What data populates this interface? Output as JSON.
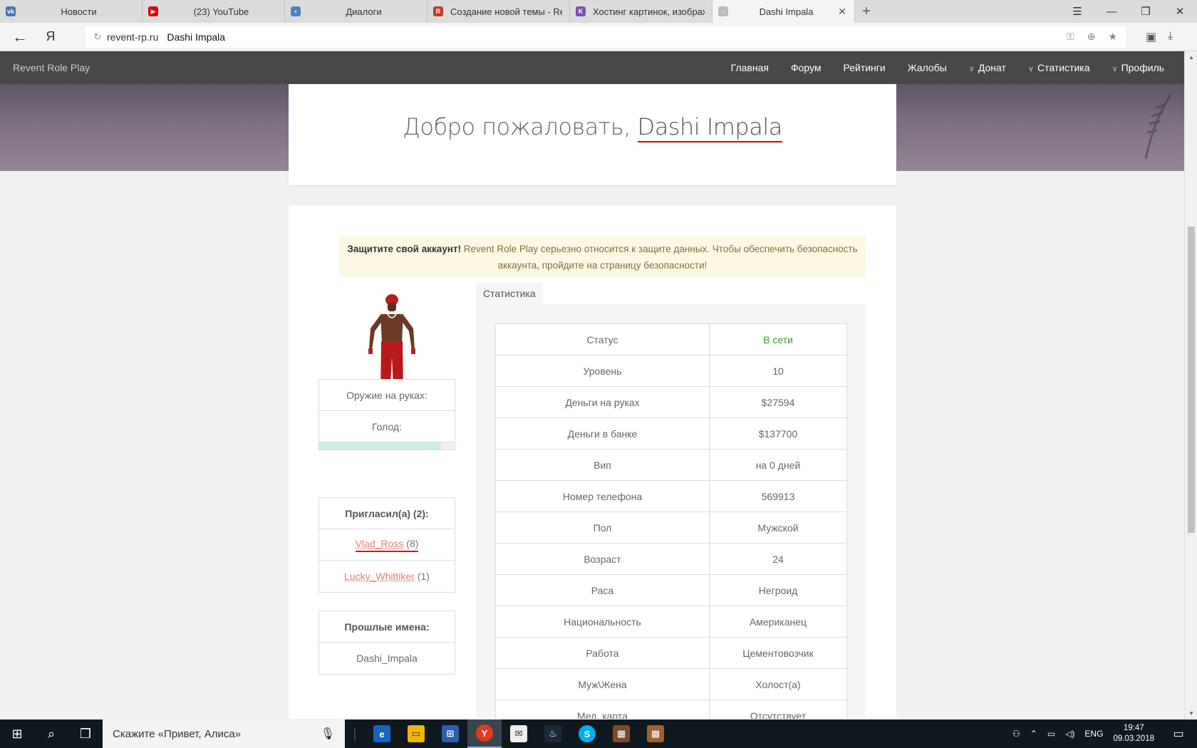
{
  "browser": {
    "tabs": [
      {
        "title": "Новости",
        "favicon": "vk-icon",
        "color": "#4a76a8",
        "glyph": "vk"
      },
      {
        "title": "(23) YouTube",
        "favicon": "youtube-icon",
        "color": "#e00000",
        "glyph": "▶"
      },
      {
        "title": "Диалоги",
        "favicon": "chat-icon",
        "color": "#5181b8",
        "glyph": "▪"
      },
      {
        "title": "Создание новой темы - Rev",
        "favicon": "revent-icon",
        "color": "#c0392b",
        "glyph": "R"
      },
      {
        "title": "Хостинг картинок, изображ",
        "favicon": "k-icon",
        "color": "#7b4fb3",
        "glyph": "K"
      },
      {
        "title": "Dashi Impala",
        "favicon": "page-icon",
        "color": "#bbbbbb",
        "glyph": "▫",
        "active": true
      }
    ],
    "new_tab": "+",
    "address": {
      "domain": "revent-rp.ru",
      "page_title": "Dashi Impala"
    }
  },
  "site": {
    "brand": "Revent Role Play",
    "nav": [
      {
        "label": "Главная",
        "dropdown": false
      },
      {
        "label": "Форум",
        "dropdown": false
      },
      {
        "label": "Рейтинги",
        "dropdown": false
      },
      {
        "label": "Жалобы",
        "dropdown": false
      },
      {
        "label": "Донат",
        "dropdown": true
      },
      {
        "label": "Статистика",
        "dropdown": true
      },
      {
        "label": "Профиль",
        "dropdown": true
      }
    ],
    "welcome_prefix": "Добро пожаловать, ",
    "welcome_name": "Dashi Impala"
  },
  "alert": {
    "strong": "Защитите свой аккаунт!",
    "text": " Revent Role Play серьезно относится к защите данных. Чтобы обеспечить безопасность аккаунта, пройдите на страницу безопасности!"
  },
  "player_info": {
    "weapon_label": "Оружие на руках:",
    "hunger_label": "Голод:",
    "hunger_level": 0.9
  },
  "invited": {
    "title": "Пригласил(а) (2):",
    "users": [
      {
        "name": "Vlad_Ross",
        "count": "(8)"
      },
      {
        "name": "Lucky_Whittiker",
        "count": "(1)"
      }
    ]
  },
  "past_names": {
    "title": "Прошлые имена:",
    "names": [
      "Dashi_Impala"
    ]
  },
  "stats_tab": "Статистика",
  "stats": [
    {
      "label": "Статус",
      "value": "В сети",
      "online": true
    },
    {
      "label": "Уровень",
      "value": "10"
    },
    {
      "label": "Деньги на руках",
      "value": "$27594"
    },
    {
      "label": "Деньги в банке",
      "value": "$137700"
    },
    {
      "label": "Вип",
      "value": "на 0 дней"
    },
    {
      "label": "Номер телефона",
      "value": "569913"
    },
    {
      "label": "Пол",
      "value": "Мужской"
    },
    {
      "label": "Возраст",
      "value": "24"
    },
    {
      "label": "Раса",
      "value": "Негроид"
    },
    {
      "label": "Национальность",
      "value": "Американец"
    },
    {
      "label": "Работа",
      "value": "Цементовозчик"
    },
    {
      "label": "Муж\\Жена",
      "value": "Холост(а)"
    },
    {
      "label": "Мед. карта",
      "value": "Отсутствует"
    }
  ],
  "taskbar": {
    "search_placeholder": "Скажите «Привет, Алиса»",
    "lang": "ENG",
    "time": "19:47",
    "date": "09.03.2018"
  }
}
